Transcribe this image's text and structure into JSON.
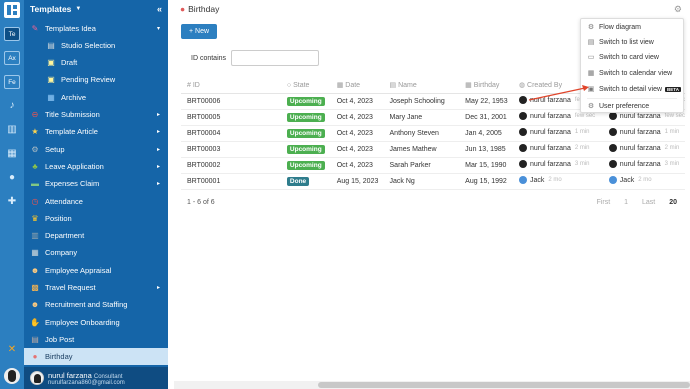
{
  "rail": {
    "workspaces": [
      "Te",
      "Ax",
      "Fe"
    ]
  },
  "sidebar": {
    "title": "Templates",
    "collapse": "«",
    "items": [
      {
        "label": "Templates Idea",
        "icon": "pencil-icon",
        "arrow": "▾",
        "indent": 0
      },
      {
        "label": "Studio Selection",
        "icon": "clapper-icon",
        "arrow": "",
        "indent": 1
      },
      {
        "label": "Draft",
        "icon": "note-icon",
        "arrow": "",
        "indent": 1
      },
      {
        "label": "Pending Review",
        "icon": "note-icon",
        "arrow": "",
        "indent": 1
      },
      {
        "label": "Archive",
        "icon": "archive-icon",
        "arrow": "",
        "indent": 1
      },
      {
        "label": "Title Submission",
        "icon": "no-entry-icon",
        "arrow": "▸",
        "indent": 0
      },
      {
        "label": "Template Article",
        "icon": "star-icon",
        "arrow": "▸",
        "indent": 0
      },
      {
        "label": "Setup",
        "icon": "gear-icon",
        "arrow": "▸",
        "indent": 0
      },
      {
        "label": "Leave Application",
        "icon": "palm-icon",
        "arrow": "▸",
        "indent": 0
      },
      {
        "label": "Expenses Claim",
        "icon": "money-icon",
        "arrow": "▸",
        "indent": 0
      },
      {
        "label": "Attendance",
        "icon": "clock-icon",
        "arrow": "",
        "indent": 0
      },
      {
        "label": "Position",
        "icon": "trophy-icon",
        "arrow": "",
        "indent": 0
      },
      {
        "label": "Department",
        "icon": "building-icon",
        "arrow": "",
        "indent": 0
      },
      {
        "label": "Company",
        "icon": "office-icon",
        "arrow": "",
        "indent": 0
      },
      {
        "label": "Employee Appraisal",
        "icon": "person-icon",
        "arrow": "",
        "indent": 0
      },
      {
        "label": "Travel Request",
        "icon": "luggage-icon",
        "arrow": "▸",
        "indent": 0
      },
      {
        "label": "Recruitment and Staffing",
        "icon": "people-icon",
        "arrow": "",
        "indent": 0
      },
      {
        "label": "Employee Onboarding",
        "icon": "handshake-icon",
        "arrow": "",
        "indent": 0
      },
      {
        "label": "Job Post",
        "icon": "briefcase-icon",
        "arrow": "",
        "indent": 0
      },
      {
        "label": "Birthday",
        "icon": "cake-icon",
        "arrow": "",
        "indent": 0
      }
    ]
  },
  "user": {
    "name": "nurul farzana",
    "role": "Consultant",
    "email": "nurulfarzana860@gmail.com"
  },
  "page": {
    "title": "Birthday",
    "new_label": "New",
    "filter_label": "ID",
    "filter_op": "contains",
    "filter_value": ""
  },
  "table": {
    "headers": [
      "ID",
      "State",
      "Date",
      "Name",
      "Birthday",
      "Created By"
    ],
    "rows": [
      {
        "id": "BRT00006",
        "state": "Upcoming",
        "date": "Oct 4, 2023",
        "name": "Joseph Schooling",
        "birthday": "May 22, 1953",
        "by": "nurul farzana",
        "ago": "few sec",
        "by2": "nurul farzana",
        "ago2": "few sec"
      },
      {
        "id": "BRT00005",
        "state": "Upcoming",
        "date": "Oct 4, 2023",
        "name": "Mary Jane",
        "birthday": "Dec 31, 2001",
        "by": "nurul farzana",
        "ago": "few sec",
        "by2": "nurul farzana",
        "ago2": "few sec"
      },
      {
        "id": "BRT00004",
        "state": "Upcoming",
        "date": "Oct 4, 2023",
        "name": "Anthony Steven",
        "birthday": "Jan 4, 2005",
        "by": "nurul farzana",
        "ago": "1 min",
        "by2": "nurul farzana",
        "ago2": "1 min"
      },
      {
        "id": "BRT00003",
        "state": "Upcoming",
        "date": "Oct 4, 2023",
        "name": "James Mathew",
        "birthday": "Jun 13, 1985",
        "by": "nurul farzana",
        "ago": "2 min",
        "by2": "nurul farzana",
        "ago2": "2 min"
      },
      {
        "id": "BRT00002",
        "state": "Upcoming",
        "date": "Oct 4, 2023",
        "name": "Sarah Parker",
        "birthday": "Mar 15, 1990",
        "by": "nurul farzana",
        "ago": "3 min",
        "by2": "nurul farzana",
        "ago2": "3 min"
      },
      {
        "id": "BRT00001",
        "state": "Done",
        "date": "Aug 15, 2023",
        "name": "Jack Ng",
        "birthday": "Aug 15, 1992",
        "by": "Jack",
        "ago": "2 mo",
        "by2": "Jack",
        "ago2": "2 mo"
      }
    ]
  },
  "pager": {
    "range": "1 - 6 of 6",
    "first": "First",
    "prev": "1",
    "last": "Last",
    "size": "20"
  },
  "menu": {
    "items": [
      "Flow diagram",
      "Switch to list view",
      "Switch to card view",
      "Switch to calendar view",
      "Switch to detail view",
      "User preference"
    ],
    "beta": "BETA"
  }
}
